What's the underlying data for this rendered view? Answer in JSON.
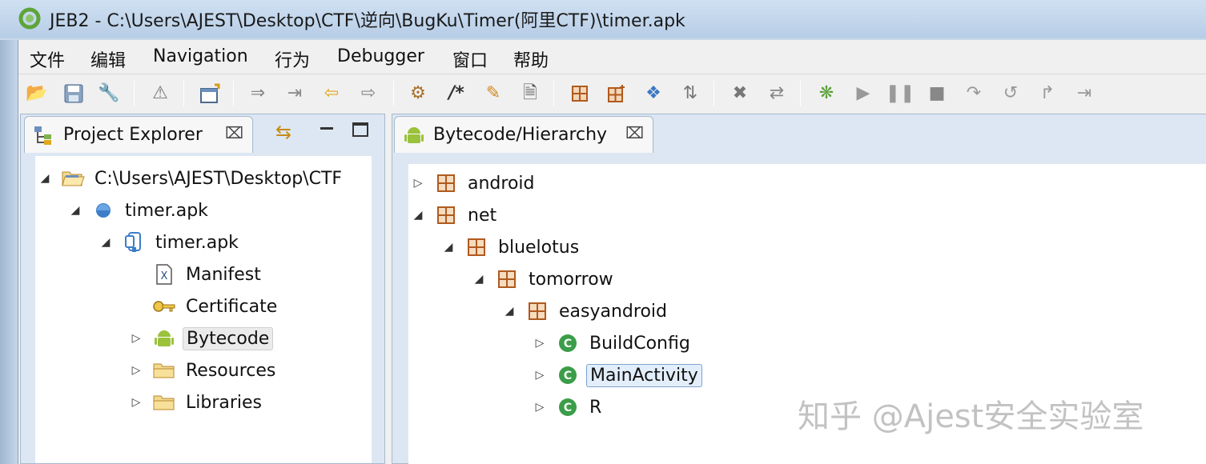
{
  "window": {
    "title": "JEB2 - C:\\Users\\AJEST\\Desktop\\CTF\\逆向\\BugKu\\Timer(阿里CTF)\\timer.apk"
  },
  "menu": [
    "文件",
    "编辑",
    "Navigation",
    "行为",
    "Debugger",
    "窗口",
    "帮助"
  ],
  "left_panel": {
    "tab_label": "Project Explorer",
    "tree": [
      {
        "label": "C:\\Users\\AJEST\\Desktop\\CTF",
        "depth": 0,
        "toggle": "expanded",
        "icon": "folder-open-icon"
      },
      {
        "label": "timer.apk",
        "depth": 1,
        "toggle": "expanded",
        "icon": "blue-dot-icon"
      },
      {
        "label": "timer.apk",
        "depth": 2,
        "toggle": "expanded",
        "icon": "apk-file-icon"
      },
      {
        "label": "Manifest",
        "depth": 3,
        "toggle": "none",
        "icon": "xml-file-icon"
      },
      {
        "label": "Certificate",
        "depth": 3,
        "toggle": "none",
        "icon": "key-icon"
      },
      {
        "label": "Bytecode",
        "depth": 3,
        "toggle": "collapsed",
        "icon": "android-icon",
        "highlight": true
      },
      {
        "label": "Resources",
        "depth": 3,
        "toggle": "collapsed",
        "icon": "folder-icon"
      },
      {
        "label": "Libraries",
        "depth": 3,
        "toggle": "collapsed",
        "icon": "folder-icon"
      }
    ]
  },
  "right_panel": {
    "tab_label": "Bytecode/Hierarchy",
    "tree": [
      {
        "label": "android",
        "depth": 0,
        "toggle": "collapsed",
        "icon": "package-icon"
      },
      {
        "label": "net",
        "depth": 0,
        "toggle": "expanded",
        "icon": "package-icon"
      },
      {
        "label": "bluelotus",
        "depth": 1,
        "toggle": "expanded",
        "icon": "package-icon"
      },
      {
        "label": "tomorrow",
        "depth": 2,
        "toggle": "expanded",
        "icon": "package-icon"
      },
      {
        "label": "easyandroid",
        "depth": 3,
        "toggle": "expanded",
        "icon": "package-icon"
      },
      {
        "label": "BuildConfig",
        "depth": 4,
        "toggle": "collapsed",
        "icon": "class-icon"
      },
      {
        "label": "MainActivity",
        "depth": 4,
        "toggle": "collapsed",
        "icon": "class-icon",
        "selected": true
      },
      {
        "label": "R",
        "depth": 4,
        "toggle": "collapsed",
        "icon": "class-icon"
      }
    ]
  },
  "toolbar": {
    "icons": [
      "open-folder-icon",
      "save-icon",
      "wrench-icon",
      "warning-icon",
      "export-icon",
      "step-into-icon",
      "step-back-icon",
      "back-arrow-icon",
      "forward-arrow-icon",
      "gears-icon",
      "comment-icon",
      "pencil-icon",
      "document-icon",
      "package-grid-icon",
      "package-add-icon",
      "move-icon",
      "tree-icon",
      "delete-icon",
      "refresh-icon",
      "debug-bug-icon",
      "resume-icon",
      "pause-icon",
      "stop-icon",
      "step-over-icon",
      "step-return-icon",
      "run-to-icon",
      "step-end-icon"
    ]
  },
  "watermark": "知乎 @Ajest安全实验室"
}
